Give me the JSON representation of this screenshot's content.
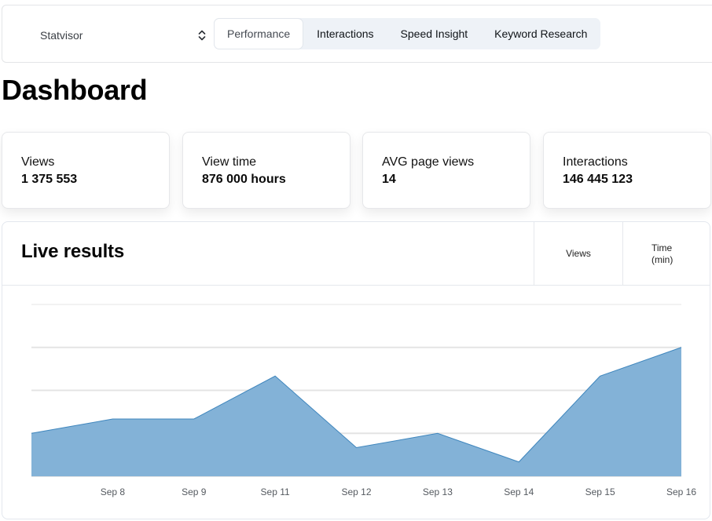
{
  "nav": {
    "site_selector": {
      "value": "Statvisor",
      "icon": "chevron-up-down-icon"
    },
    "tabs": [
      {
        "label": "Performance",
        "active": true
      },
      {
        "label": "Interactions",
        "active": false
      },
      {
        "label": "Speed Insight",
        "active": false
      },
      {
        "label": "Keyword Research",
        "active": false
      }
    ]
  },
  "page": {
    "title": "Dashboard"
  },
  "stats": [
    {
      "label": "Views",
      "value": "1 375 553"
    },
    {
      "label": "View time",
      "value": "876 000 hours"
    },
    {
      "label": "AVG page views",
      "value": "14"
    },
    {
      "label": "Interactions",
      "value": "146 445 123"
    }
  ],
  "live_results": {
    "title": "Live results",
    "metrics": [
      {
        "label": "Views"
      },
      {
        "label": "Time (min)"
      }
    ]
  },
  "colors": {
    "area_fill": "#7fb0d6",
    "area_stroke": "#3f86bd",
    "grid": "#e4e4e4",
    "tab_bg": "#eef2f7"
  },
  "chart_data": {
    "type": "area",
    "title": "Live results",
    "xlabel": "",
    "ylabel": "",
    "x": [
      "",
      "Sep 8",
      "Sep 9",
      "Sep 11",
      "Sep 12",
      "Sep 13",
      "Sep 14",
      "Sep 15",
      "Sep 16"
    ],
    "series": [
      {
        "name": "Views",
        "values": [
          30,
          40,
          40,
          70,
          20,
          30,
          10,
          70,
          90
        ]
      }
    ],
    "ylim": [
      0,
      120
    ],
    "y_gridlines": [
      0,
      30,
      60,
      90,
      120
    ],
    "grid": true,
    "legend": "none"
  }
}
